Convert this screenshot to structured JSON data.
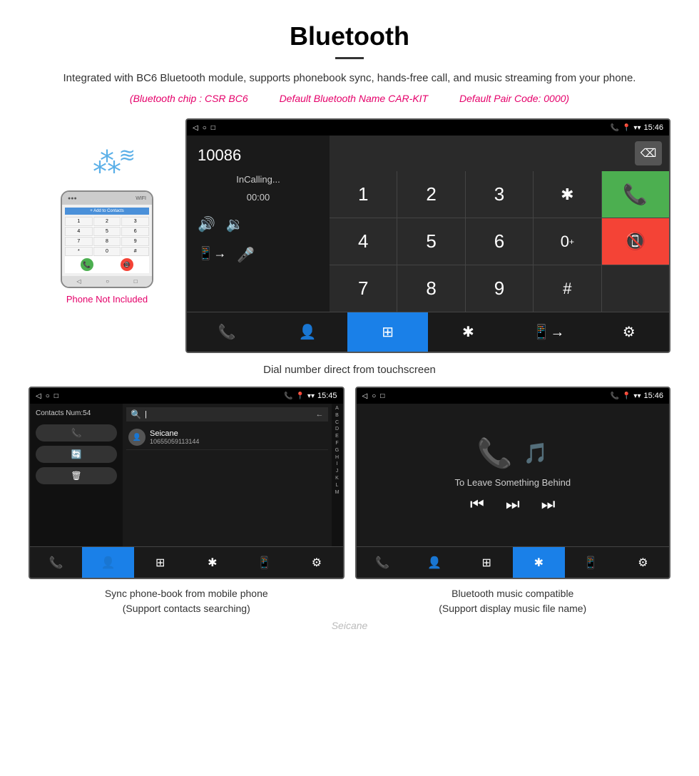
{
  "header": {
    "title": "Bluetooth",
    "description": "Integrated with BC6 Bluetooth module, supports phonebook sync, hands-free call, and music streaming from your phone.",
    "info_chip": "(Bluetooth chip : CSR BC6",
    "info_name": "Default Bluetooth Name CAR-KIT",
    "info_pair": "Default Pair Code: 0000)"
  },
  "phone_side": {
    "not_included": "Phone Not Included",
    "add_contacts_label": "+ Add to Contacts",
    "keypad_keys": [
      "1",
      "2",
      "3",
      "4",
      "5",
      "6",
      "7",
      "8",
      "9",
      "*",
      "0",
      "#"
    ]
  },
  "dial_screen": {
    "status_bar": {
      "time": "15:46"
    },
    "number": "10086",
    "status": "InCalling...",
    "timer": "00:00",
    "keypad": {
      "keys": [
        "1",
        "2",
        "3",
        "*",
        "4",
        "5",
        "6",
        "0+",
        "7",
        "8",
        "9",
        "#"
      ]
    }
  },
  "caption_main": "Dial number direct from touchscreen",
  "contacts_screen": {
    "status_time": "15:45",
    "contacts_count": "Contacts Num:54",
    "contact_name": "Seicane",
    "contact_number": "10655059113144",
    "search_placeholder": "Search",
    "alphabet": [
      "A",
      "B",
      "C",
      "D",
      "E",
      "F",
      "G",
      "H",
      "I",
      "J",
      "K",
      "L",
      "M"
    ]
  },
  "music_screen": {
    "status_time": "15:46",
    "song_title": "To Leave Something Behind"
  },
  "captions": {
    "contacts": "Sync phone-book from mobile phone",
    "contacts_sub": "(Support contacts searching)",
    "music": "Bluetooth music compatible",
    "music_sub": "(Support display music file name)"
  },
  "watermark": "Seicane"
}
